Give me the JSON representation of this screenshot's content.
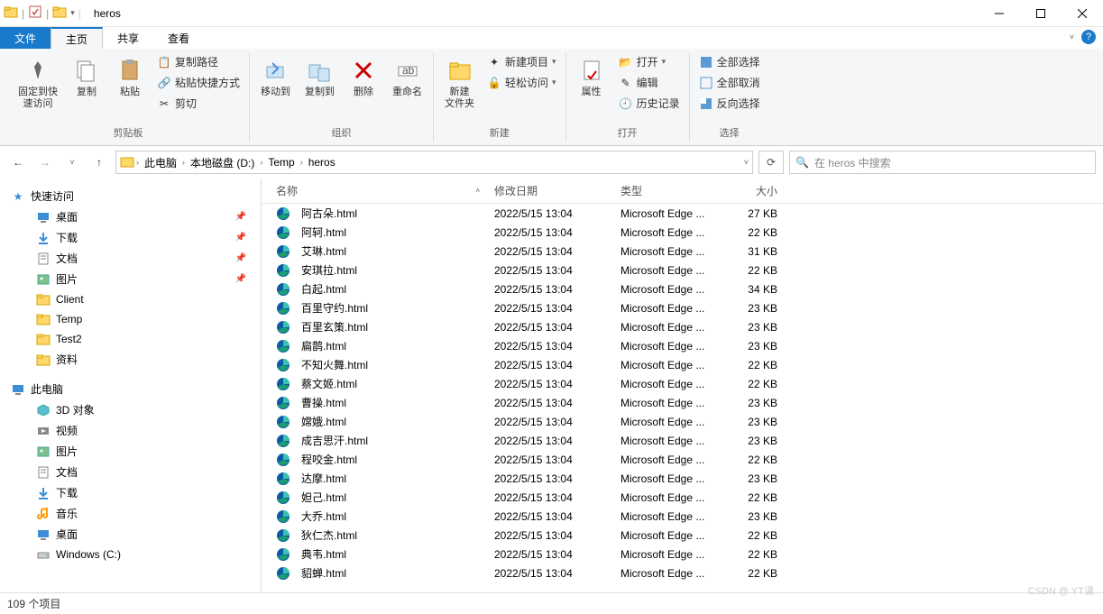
{
  "window": {
    "title": "heros"
  },
  "quickAccessIcons": [
    "folder",
    "save",
    "folder-yellow"
  ],
  "tabs": {
    "file": "文件",
    "home": "主页",
    "share": "共享",
    "view": "查看"
  },
  "ribbon": {
    "clipboard": {
      "label": "剪贴板",
      "pin": "固定到快\n速访问",
      "copy": "复制",
      "paste": "粘贴",
      "copyPath": "复制路径",
      "pasteShortcut": "粘贴快捷方式",
      "cut": "剪切"
    },
    "organize": {
      "label": "组织",
      "moveTo": "移动到",
      "copyTo": "复制到",
      "delete": "删除",
      "rename": "重命名"
    },
    "new": {
      "label": "新建",
      "newFolder": "新建\n文件夹",
      "newItem": "新建项目",
      "easyAccess": "轻松访问"
    },
    "open": {
      "label": "打开",
      "properties": "属性",
      "open": "打开",
      "edit": "编辑",
      "history": "历史记录"
    },
    "select": {
      "label": "选择",
      "selectAll": "全部选择",
      "selectNone": "全部取消",
      "invert": "反向选择"
    }
  },
  "breadcrumb": [
    "此电脑",
    "本地磁盘 (D:)",
    "Temp",
    "heros"
  ],
  "search": {
    "placeholder": "在 heros 中搜索"
  },
  "sidebar": {
    "quickAccess": "快速访问",
    "items1": [
      {
        "label": "桌面",
        "icon": "desktop",
        "pinned": true
      },
      {
        "label": "下载",
        "icon": "downloads",
        "pinned": true
      },
      {
        "label": "文档",
        "icon": "documents",
        "pinned": true
      },
      {
        "label": "图片",
        "icon": "pictures",
        "pinned": true
      },
      {
        "label": "Client",
        "icon": "folder"
      },
      {
        "label": "Temp",
        "icon": "folder"
      },
      {
        "label": "Test2",
        "icon": "folder"
      },
      {
        "label": "资料",
        "icon": "folder"
      }
    ],
    "thisPC": "此电脑",
    "items2": [
      {
        "label": "3D 对象",
        "icon": "3d"
      },
      {
        "label": "视频",
        "icon": "videos"
      },
      {
        "label": "图片",
        "icon": "pictures"
      },
      {
        "label": "文档",
        "icon": "documents"
      },
      {
        "label": "下载",
        "icon": "downloads"
      },
      {
        "label": "音乐",
        "icon": "music"
      },
      {
        "label": "桌面",
        "icon": "desktop"
      },
      {
        "label": "Windows (C:)",
        "icon": "drive"
      }
    ]
  },
  "columns": {
    "name": "名称",
    "date": "修改日期",
    "type": "类型",
    "size": "大小"
  },
  "files": [
    {
      "name": "阿古朵.html",
      "date": "2022/5/15 13:04",
      "type": "Microsoft Edge ...",
      "size": "27 KB"
    },
    {
      "name": "阿轲.html",
      "date": "2022/5/15 13:04",
      "type": "Microsoft Edge ...",
      "size": "22 KB"
    },
    {
      "name": "艾琳.html",
      "date": "2022/5/15 13:04",
      "type": "Microsoft Edge ...",
      "size": "31 KB"
    },
    {
      "name": "安琪拉.html",
      "date": "2022/5/15 13:04",
      "type": "Microsoft Edge ...",
      "size": "22 KB"
    },
    {
      "name": "白起.html",
      "date": "2022/5/15 13:04",
      "type": "Microsoft Edge ...",
      "size": "34 KB"
    },
    {
      "name": "百里守约.html",
      "date": "2022/5/15 13:04",
      "type": "Microsoft Edge ...",
      "size": "23 KB"
    },
    {
      "name": "百里玄策.html",
      "date": "2022/5/15 13:04",
      "type": "Microsoft Edge ...",
      "size": "23 KB"
    },
    {
      "name": "扁鹊.html",
      "date": "2022/5/15 13:04",
      "type": "Microsoft Edge ...",
      "size": "23 KB"
    },
    {
      "name": "不知火舞.html",
      "date": "2022/5/15 13:04",
      "type": "Microsoft Edge ...",
      "size": "22 KB"
    },
    {
      "name": "蔡文姬.html",
      "date": "2022/5/15 13:04",
      "type": "Microsoft Edge ...",
      "size": "22 KB"
    },
    {
      "name": "曹操.html",
      "date": "2022/5/15 13:04",
      "type": "Microsoft Edge ...",
      "size": "23 KB"
    },
    {
      "name": "嫦娥.html",
      "date": "2022/5/15 13:04",
      "type": "Microsoft Edge ...",
      "size": "23 KB"
    },
    {
      "name": "成吉思汗.html",
      "date": "2022/5/15 13:04",
      "type": "Microsoft Edge ...",
      "size": "23 KB"
    },
    {
      "name": "程咬金.html",
      "date": "2022/5/15 13:04",
      "type": "Microsoft Edge ...",
      "size": "22 KB"
    },
    {
      "name": "达摩.html",
      "date": "2022/5/15 13:04",
      "type": "Microsoft Edge ...",
      "size": "23 KB"
    },
    {
      "name": "妲己.html",
      "date": "2022/5/15 13:04",
      "type": "Microsoft Edge ...",
      "size": "22 KB"
    },
    {
      "name": "大乔.html",
      "date": "2022/5/15 13:04",
      "type": "Microsoft Edge ...",
      "size": "23 KB"
    },
    {
      "name": "狄仁杰.html",
      "date": "2022/5/15 13:04",
      "type": "Microsoft Edge ...",
      "size": "22 KB"
    },
    {
      "name": "典韦.html",
      "date": "2022/5/15 13:04",
      "type": "Microsoft Edge ...",
      "size": "22 KB"
    },
    {
      "name": "貂蝉.html",
      "date": "2022/5/15 13:04",
      "type": "Microsoft Edge ...",
      "size": "22 KB"
    }
  ],
  "status": {
    "itemCount": "109 个项目"
  },
  "watermark": "CSDN @ YT课"
}
